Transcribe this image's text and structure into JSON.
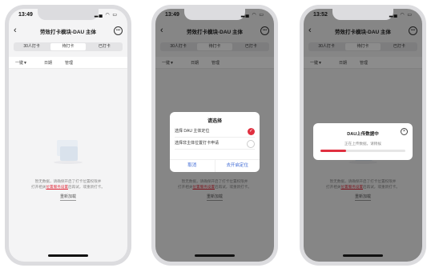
{
  "status": {
    "time_1": "13:49",
    "time_2": "13:49",
    "time_3": "13:52"
  },
  "nav": {
    "title": "劳效打卡模块-DAU 主体"
  },
  "tabs": [
    "30人打卡",
    "待打卡",
    "已打卡"
  ],
  "filter": {
    "dropdown": "一键▼",
    "col2": "日期",
    "col3": "管理"
  },
  "empty": {
    "line1": "暂无数据，请确保开启了打卡位置权限并",
    "line2_pre": "打开相关",
    "line2_link": "位置服务设置",
    "line2_post": "后再试，或重新打卡。",
    "action": "重新加载"
  },
  "dialog1": {
    "title": "请选择",
    "option1": "选择 DAU 主体定位",
    "option2": "选择非主体位置打卡申请",
    "cancel": "取消",
    "confirm": "去开启定位"
  },
  "dialog2": {
    "title": "DAU上传数据中",
    "subtitle": "正在上传数据，请稍候",
    "progress_percent": 30
  },
  "colors": {
    "accent": "#e03040",
    "link": "#3a66d4"
  },
  "icons": [
    "back-icon",
    "more-icon",
    "check-icon",
    "close-icon"
  ]
}
